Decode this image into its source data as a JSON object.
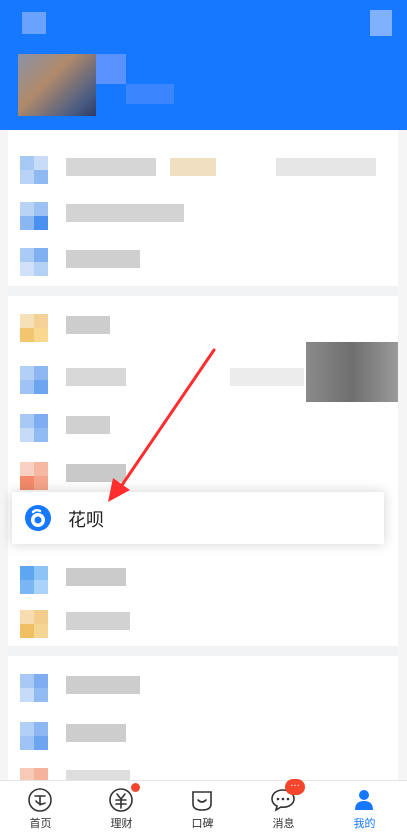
{
  "highlighted_item": {
    "label": "花呗",
    "icon": "huabei-icon"
  },
  "tabbar": {
    "tabs": [
      {
        "label": "首页",
        "icon": "home-icon"
      },
      {
        "label": "理财",
        "icon": "wealth-icon"
      },
      {
        "label": "口碑",
        "icon": "koubei-icon"
      },
      {
        "label": "消息",
        "icon": "message-icon",
        "badge": "···"
      },
      {
        "label": "我的",
        "icon": "profile-icon",
        "active": true
      }
    ]
  },
  "colors": {
    "brand_blue": "#1677ff",
    "badge_red": "#f5452c",
    "arrow_red": "#ff2d2d"
  }
}
